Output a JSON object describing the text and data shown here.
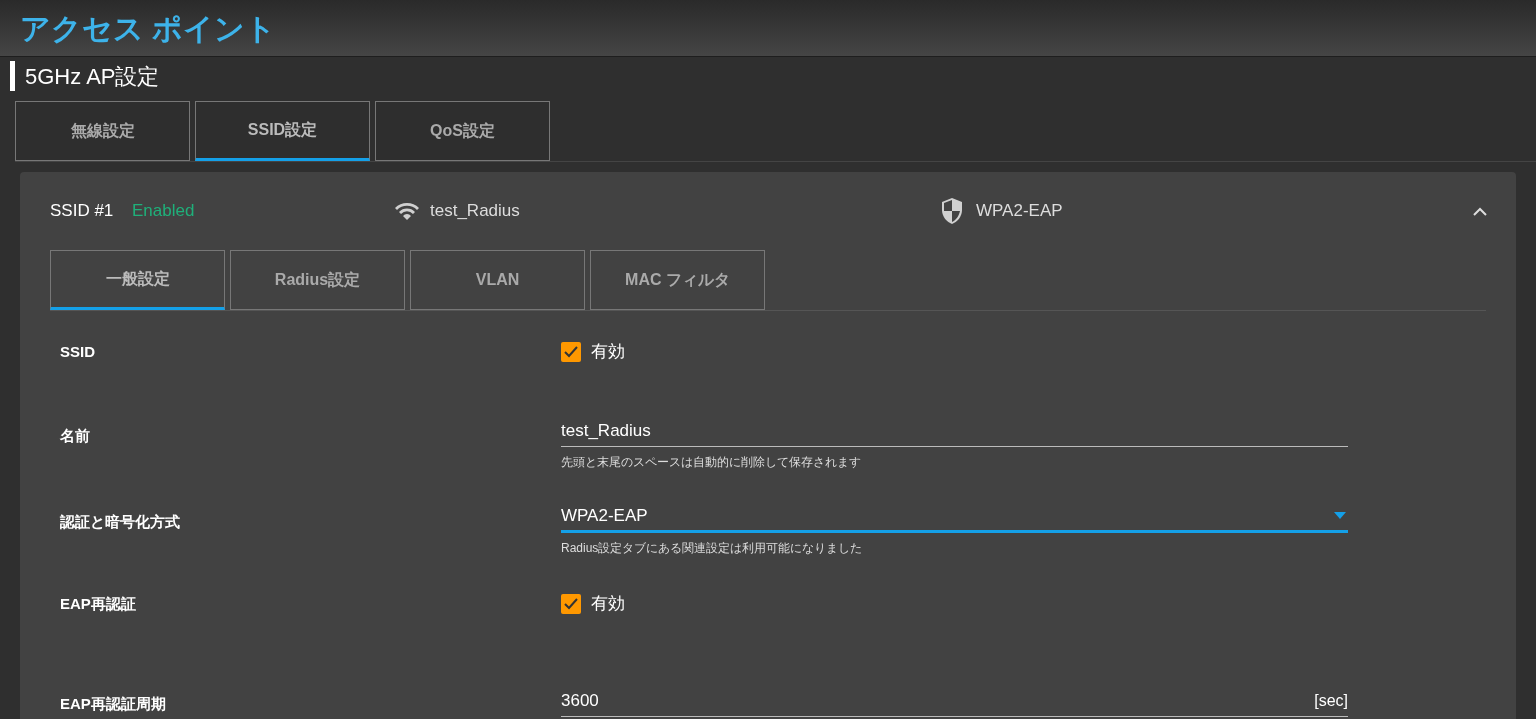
{
  "header": {
    "title": "アクセス ポイント"
  },
  "section": {
    "title": "5GHz AP設定"
  },
  "tabs": [
    {
      "label": "無線設定",
      "selected": false
    },
    {
      "label": "SSID設定",
      "selected": true
    },
    {
      "label": "QoS設定",
      "selected": false
    }
  ],
  "ssid_card": {
    "name": "SSID #1",
    "status": "Enabled",
    "ssid": "test_Radius",
    "security": "WPA2-EAP",
    "expanded": true,
    "tabs": [
      {
        "label": "一般設定",
        "selected": true
      },
      {
        "label": "Radius設定",
        "selected": false
      },
      {
        "label": "VLAN",
        "selected": false
      },
      {
        "label": "MAC フィルタ",
        "selected": false
      }
    ],
    "fields": [
      {
        "kind": "checkbox",
        "label": "SSID",
        "checked": true,
        "text": "有効"
      },
      {
        "kind": "text",
        "label": "名前",
        "value": "test_Radius",
        "hint": "先頭と末尾のスペースは自動的に削除して保存されます"
      },
      {
        "kind": "select",
        "label": "認証と暗号化方式",
        "value": "WPA2-EAP",
        "hint": "Radius設定タブにある関連設定は利用可能になりました"
      },
      {
        "kind": "checkbox",
        "label": "EAP再認証",
        "checked": true,
        "text": "有効"
      },
      {
        "kind": "unit",
        "label": "EAP再認証周期",
        "value": "3600",
        "unit": "[sec]"
      }
    ]
  }
}
